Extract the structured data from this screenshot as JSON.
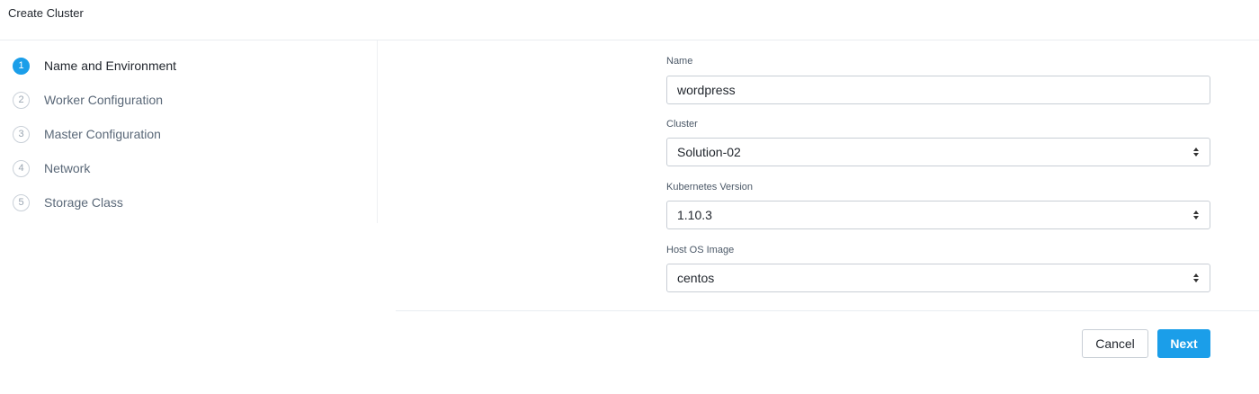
{
  "header": {
    "title": "Create Cluster"
  },
  "steps": [
    {
      "number": "1",
      "label": "Name and Environment",
      "active": true
    },
    {
      "number": "2",
      "label": "Worker Configuration",
      "active": false
    },
    {
      "number": "3",
      "label": "Master Configuration",
      "active": false
    },
    {
      "number": "4",
      "label": "Network",
      "active": false
    },
    {
      "number": "5",
      "label": "Storage Class",
      "active": false
    }
  ],
  "form": {
    "name": {
      "label": "Name",
      "value": "wordpress"
    },
    "cluster": {
      "label": "Cluster",
      "value": "Solution-02"
    },
    "kubernetes_version": {
      "label": "Kubernetes Version",
      "value": "1.10.3"
    },
    "host_os_image": {
      "label": "Host OS Image",
      "value": "centos"
    }
  },
  "buttons": {
    "cancel": "Cancel",
    "next": "Next"
  },
  "colors": {
    "accent": "#1b9ee9",
    "border": "#c8ced5",
    "divider": "#e9edf1"
  }
}
